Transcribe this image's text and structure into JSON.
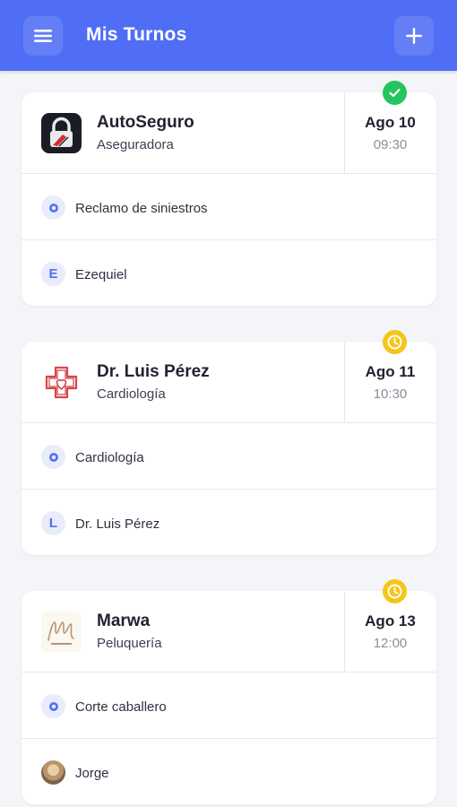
{
  "header": {
    "title": "Mis Turnos",
    "menu_icon": "menu-icon",
    "add_icon": "plus-icon",
    "background_color": "#4f6ef5"
  },
  "appointments": [
    {
      "name": "AutoSeguro",
      "category": "Aseguradora",
      "date": "Ago 10",
      "time": "09:30",
      "status": "confirmed",
      "status_icon": "check-circle-icon",
      "status_color": "#22c55e",
      "service": "Reclamo de siniestros",
      "staff_initial": "E",
      "staff": "Ezequiel"
    },
    {
      "name": "Dr. Luis Pérez",
      "category": "Cardiología",
      "date": "Ago 11",
      "time": "10:30",
      "status": "pending",
      "status_icon": "clock-icon",
      "status_color": "#f5c518",
      "service": "Cardiología",
      "staff_initial": "L",
      "staff": "Dr. Luis Pérez"
    },
    {
      "name": "Marwa",
      "category": "Peluquería",
      "date": "Ago 13",
      "time": "12:00",
      "status": "pending",
      "status_icon": "clock-icon",
      "status_color": "#f5c518",
      "service": "Corte caballero",
      "staff_initial": "",
      "staff": "Jorge"
    }
  ]
}
